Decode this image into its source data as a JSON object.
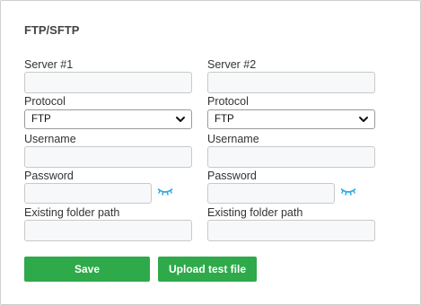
{
  "section": {
    "title": "FTP/SFTP"
  },
  "servers": [
    {
      "header": "Server #1",
      "protocol_label": "Protocol",
      "protocol_value": "FTP",
      "username_label": "Username",
      "username_value": "",
      "password_label": "Password",
      "password_value": "",
      "folder_label": "Existing folder path",
      "folder_value": "",
      "server_value": ""
    },
    {
      "header": "Server #2",
      "protocol_label": "Protocol",
      "protocol_value": "FTP",
      "username_label": "Username",
      "username_value": "",
      "password_label": "Password",
      "password_value": "",
      "folder_label": "Existing folder path",
      "folder_value": "",
      "server_value": ""
    }
  ],
  "actions": {
    "save_label": "Save",
    "upload_label": "Upload test file"
  },
  "colors": {
    "button_green": "#2eaa4a",
    "eye_icon": "#29a9e0"
  },
  "icons": {
    "protocol_dropdown": "chevron-down-icon",
    "password_toggle": "eye-closed-icon"
  }
}
